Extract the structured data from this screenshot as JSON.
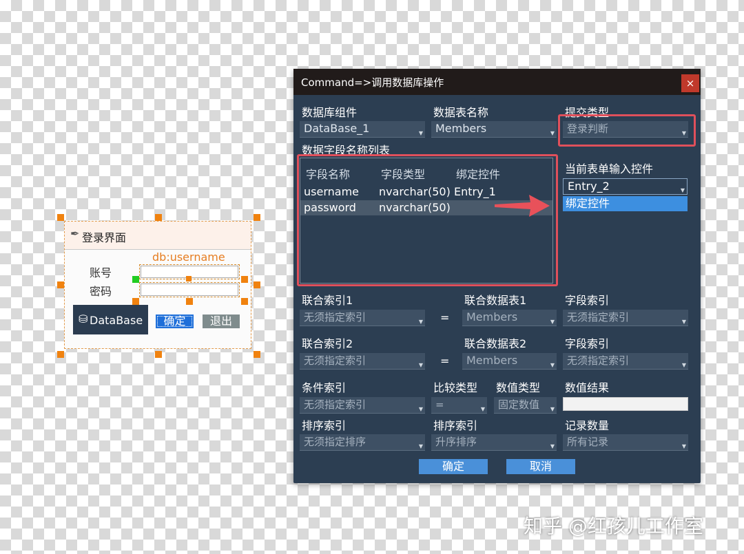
{
  "form_preview": {
    "title": "登录界面",
    "db_label": "db:username",
    "account_label": "账号",
    "password_label": "密码",
    "database_label": "DataBase",
    "confirm_label": "确定",
    "exit_label": "退出"
  },
  "dialog": {
    "title": "Command=>调用数据库操作",
    "close": "×",
    "db_component_label": "数据库组件",
    "db_component_value": "DataBase_1",
    "table_name_label": "数据表名称",
    "table_name_value": "Members",
    "submit_type_label": "提交类型",
    "submit_type_value": "登录判断",
    "field_list_label": "数据字段名称列表",
    "field_table": {
      "headers": [
        "字段名称",
        "字段类型",
        "绑定控件"
      ],
      "rows": [
        {
          "name": "username",
          "type": "nvarchar(50)",
          "control": "Entry_1"
        },
        {
          "name": "password",
          "type": "nvarchar(50)",
          "control": ""
        }
      ]
    },
    "current_input_label": "当前表单输入控件",
    "current_input_value": "Entry_2",
    "bind_option": "绑定控件",
    "join_index1_label": "联合索引1",
    "join_index1_value": "无须指定索引",
    "join_table1_label": "联合数据表1",
    "join_table1_value": "Members",
    "field_index1_label": "字段索引",
    "field_index1_value": "无须指定索引",
    "join_index2_label": "联合索引2",
    "join_index2_value": "无须指定索引",
    "join_table2_label": "联合数据表2",
    "join_table2_value": "Members",
    "field_index2_label": "字段索引",
    "field_index2_value": "无须指定索引",
    "equals": "=",
    "condition_index_label": "条件索引",
    "condition_index_value": "无须指定索引",
    "compare_type_label": "比较类型",
    "compare_type_value": "=",
    "value_type_label": "数值类型",
    "value_type_value": "固定数值",
    "value_result_label": "数值结果",
    "value_result_value": "",
    "sort_index1_label": "排序索引",
    "sort_index1_value": "无须指定排序",
    "sort_index2_label": "排序索引",
    "sort_index2_value": "升序排序",
    "record_count_label": "记录数量",
    "record_count_value": "所有记录",
    "ok_label": "确定",
    "cancel_label": "取消"
  },
  "watermark": "知乎 @红孩儿工作室",
  "colors": {
    "dialog_bg": "#2c3e52",
    "titlebar_bg": "#211b1a",
    "highlight_red": "#e0505b",
    "button_blue": "#4a90d9",
    "handle_orange": "#f0820f"
  }
}
